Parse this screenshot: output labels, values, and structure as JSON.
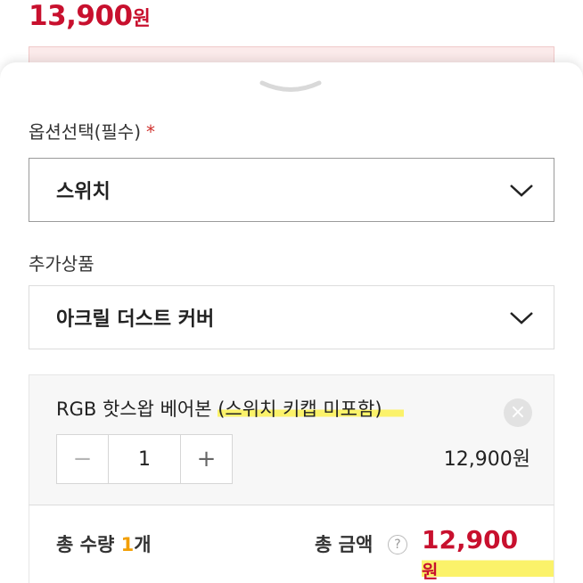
{
  "product": {
    "price": "13,900",
    "unit": "원"
  },
  "option": {
    "label": "옵션선택(필수)",
    "required_mark": "*",
    "selected": "스위치"
  },
  "addon": {
    "label": "추가상품",
    "selected": "아크릴 더스트 커버"
  },
  "item": {
    "name_prefix": "RGB 핫스왑 베어본 ",
    "name_highlight": "(스위치 키캡 미포함)",
    "remove_icon": "×",
    "minus": "−",
    "plus": "+",
    "quantity": "1",
    "price": "12,900원"
  },
  "summary": {
    "qty_label": "총 수량 ",
    "qty_value": "1",
    "qty_unit": "개",
    "total_label": "총 금액",
    "help": "?",
    "total_price": "12,900",
    "total_unit": "원"
  },
  "colors": {
    "price_red": "#c8102e",
    "qty_accent": "#f29f05",
    "highlight": "#fbf26a"
  }
}
